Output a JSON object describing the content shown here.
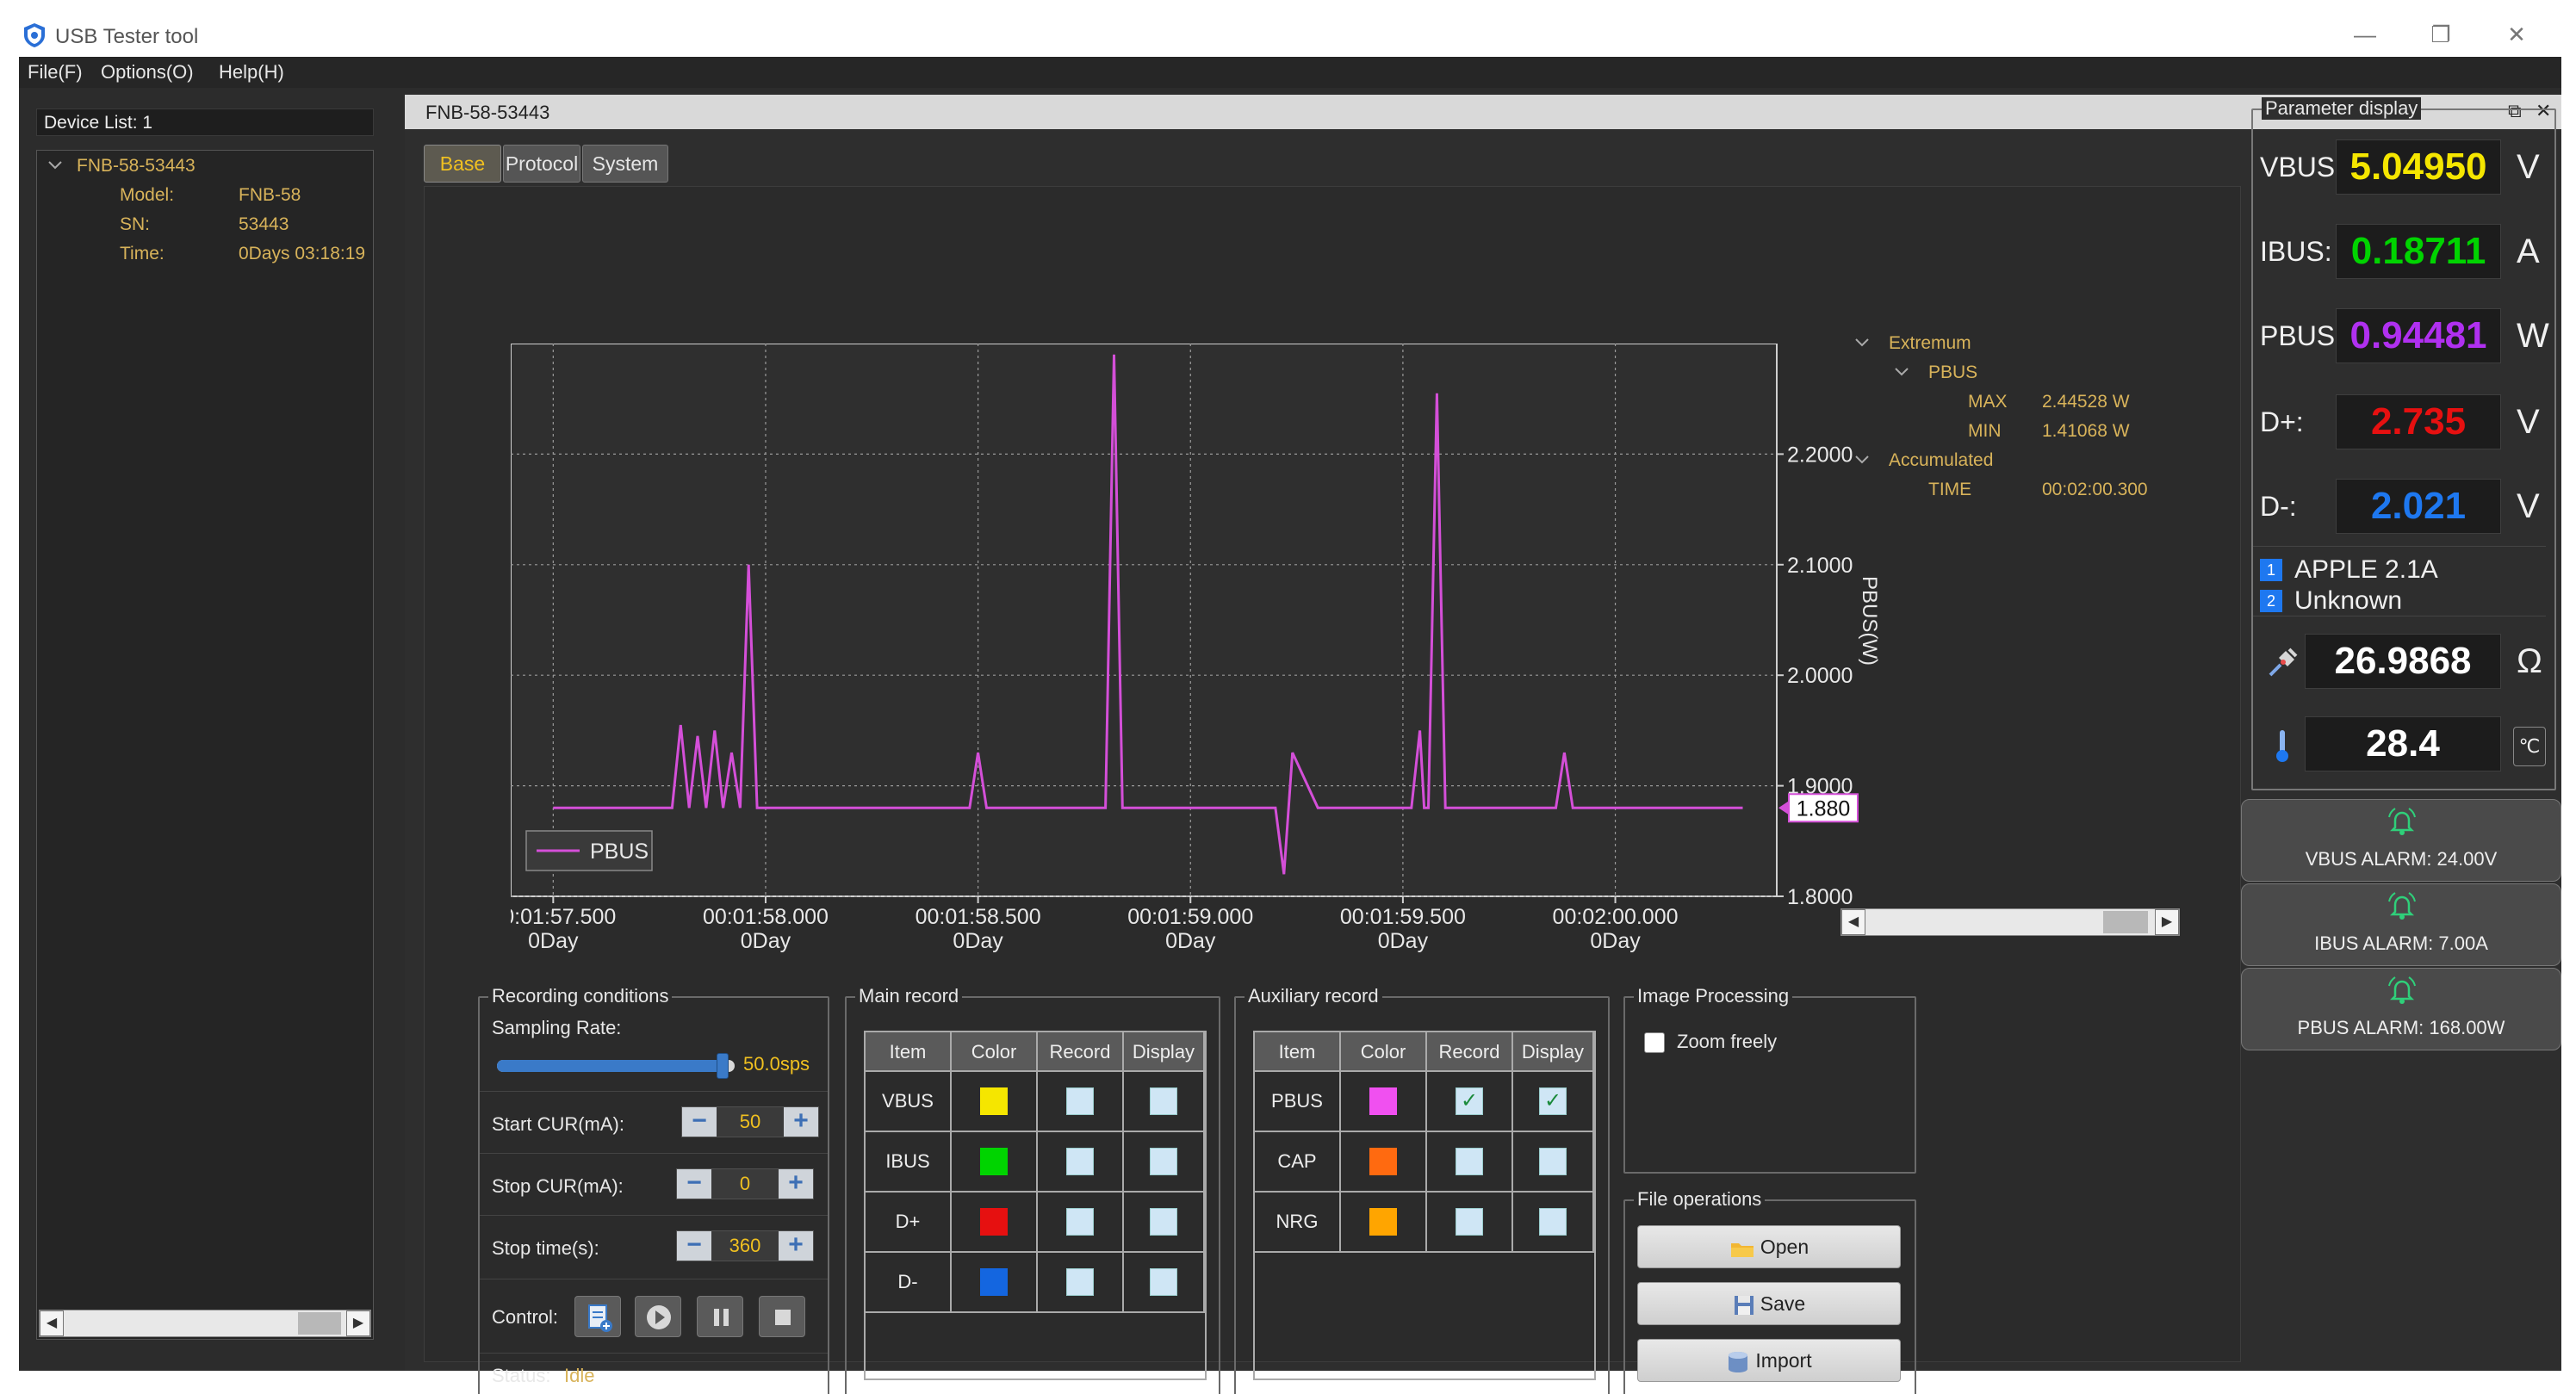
{
  "window": {
    "title": "USB Tester tool",
    "minimize": "—",
    "restore": "❐",
    "close": "✕",
    "icon": "shield-app-icon"
  },
  "menu": {
    "file": "File(F)",
    "options": "Options(O)",
    "help": "Help(H)"
  },
  "device_list": {
    "header": "Device List: 1",
    "device": "FNB-58-53443",
    "model_label": "Model:",
    "model": "FNB-58",
    "sn_label": "SN:",
    "sn": "53443",
    "time_label": "Time:",
    "time": "0Days 03:18:19"
  },
  "doc": {
    "title": "FNB-58-53443",
    "float_icon": "⧉",
    "close_icon": "✕",
    "tabs": [
      "Base",
      "Protocol",
      "System"
    ]
  },
  "chart_data": {
    "type": "line",
    "ylabel": "PBUS(W)",
    "xlabel": "",
    "ylim": [
      1.8,
      2.25
    ],
    "y_ticks": [
      "2.2000",
      "2.1000",
      "2.0000",
      "1.9000",
      "1.8000"
    ],
    "x_ticks": [
      "00:01:57.500",
      "00:01:58.000",
      "00:01:58.500",
      "00:01:59.000",
      "00:01:59.500",
      "00:02:00.000"
    ],
    "x_tick_sublabel": "0Day",
    "legend": "PBUS",
    "current_marker": "1.880",
    "grid": true,
    "series": [
      {
        "name": "PBUS",
        "color": "#d44fd8",
        "x": [
          57.5,
          57.55,
          57.6,
          57.65,
          57.7,
          57.75,
          57.78,
          57.8,
          57.82,
          57.84,
          57.86,
          57.88,
          57.9,
          57.92,
          57.94,
          57.96,
          57.98,
          58.0,
          58.02,
          58.05,
          58.1,
          58.2,
          58.3,
          58.4,
          58.48,
          58.5,
          58.52,
          58.6,
          58.7,
          58.8,
          58.82,
          58.84,
          58.86,
          58.88,
          58.9,
          58.95,
          59.0,
          59.1,
          59.15,
          59.18,
          59.2,
          59.22,
          59.24,
          59.3,
          59.4,
          59.5,
          59.52,
          59.54,
          59.55,
          59.56,
          59.58,
          59.6,
          59.7,
          59.8,
          59.86,
          59.88,
          59.9,
          59.95,
          60.0,
          60.1,
          60.2,
          60.3
        ],
        "y": [
          1.88,
          1.88,
          1.88,
          1.88,
          1.88,
          1.88,
          1.88,
          1.955,
          1.88,
          1.945,
          1.88,
          1.95,
          1.88,
          1.93,
          1.88,
          2.1,
          1.88,
          1.88,
          1.88,
          1.88,
          1.88,
          1.88,
          1.88,
          1.88,
          1.88,
          1.93,
          1.88,
          1.88,
          1.88,
          1.88,
          2.29,
          1.88,
          1.88,
          1.88,
          1.88,
          1.88,
          1.88,
          1.88,
          1.88,
          1.88,
          1.88,
          1.82,
          1.93,
          1.88,
          1.88,
          1.88,
          1.88,
          1.95,
          1.88,
          1.88,
          2.255,
          1.88,
          1.88,
          1.88,
          1.88,
          1.93,
          1.88,
          1.88,
          1.88,
          1.88,
          1.88,
          1.88
        ]
      }
    ]
  },
  "extremum": {
    "title": "Extremum",
    "node": "PBUS",
    "max_label": "MAX",
    "max": "2.44528 W",
    "min_label": "MIN",
    "min": "1.41068 W",
    "accumulated": "Accumulated",
    "time_label": "TIME",
    "time": "00:02:00.300"
  },
  "recording": {
    "title": "Recording conditions",
    "rate_label": "Sampling Rate:",
    "rate_value": "50.0sps",
    "rate_fraction": 0.95,
    "start_label": "Start CUR(mA):",
    "start_value": "50",
    "stop_label": "Stop CUR(mA):",
    "stop_value": "0",
    "stoptime_label": "Stop time(s):",
    "stoptime_value": "360",
    "control_label": "Control:",
    "status_label": "Status:",
    "status_value": "Idle"
  },
  "main_record": {
    "title": "Main record",
    "headers": [
      "Item",
      "Color",
      "Record",
      "Display"
    ],
    "rows": [
      {
        "item": "VBUS",
        "color": "#f5e600",
        "record": false,
        "display": false
      },
      {
        "item": "IBUS",
        "color": "#00d400",
        "record": false,
        "display": false
      },
      {
        "item": "D+",
        "color": "#e61010",
        "record": false,
        "display": false
      },
      {
        "item": "D-",
        "color": "#1466e0",
        "record": false,
        "display": false
      }
    ]
  },
  "aux_record": {
    "title": "Auxiliary record",
    "headers": [
      "Item",
      "Color",
      "Record",
      "Display"
    ],
    "rows": [
      {
        "item": "PBUS",
        "color": "#f050f0",
        "record": true,
        "display": true
      },
      {
        "item": "CAP",
        "color": "#ff6a10",
        "record": false,
        "display": false
      },
      {
        "item": "NRG",
        "color": "#ffa500",
        "record": false,
        "display": false
      }
    ]
  },
  "image_processing": {
    "title": "Image Processing",
    "zoom_label": "Zoom freely"
  },
  "file_ops": {
    "title": "File operations",
    "open": "Open",
    "save": "Save",
    "import": "Import"
  },
  "params": {
    "title": "Parameter display",
    "vbus_label": "VBUS:",
    "vbus": "5.04950",
    "vbus_unit": "V",
    "vbus_color": "#f5e600",
    "ibus_label": "IBUS:",
    "ibus": "0.18711",
    "ibus_unit": "A",
    "ibus_color": "#00d400",
    "pbus_label": "PBUS:",
    "pbus": "0.94481",
    "pbus_unit": "W",
    "pbus_color": "#b030f0",
    "dp_label": "D+:",
    "dp": "2.735",
    "dp_unit": "V",
    "dp_color": "#e61010",
    "dm_label": "D-:",
    "dm": "2.021",
    "dm_unit": "V",
    "dm_color": "#1e78f0",
    "proto1_badge": "1",
    "proto1": "APPLE 2.1A",
    "proto2_badge": "2",
    "proto2": "Unknown",
    "resistance": "26.9868",
    "resistance_unit": "Ω",
    "temperature": "28.4",
    "temperature_unit": "℃",
    "alarm_vbus": "VBUS ALARM: 24.00V",
    "alarm_ibus": "IBUS ALARM: 7.00A",
    "alarm_pbus": "PBUS ALARM: 168.00W"
  }
}
